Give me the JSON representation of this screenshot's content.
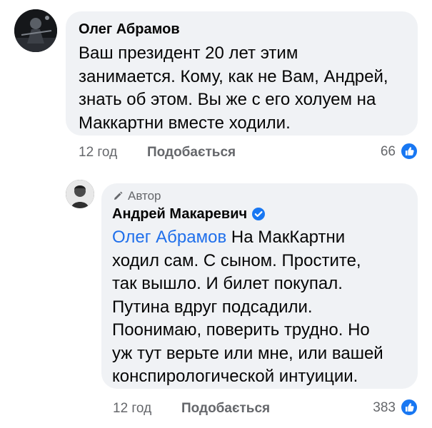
{
  "comments": [
    {
      "author": "Олег Абрамов",
      "text": "Ваш президент 20 лет этим\nзанимается. Кому, как не Вам, Андрей,\nзнать об этом. Вы же с его холуем на\nМаккартни вместе ходили.",
      "time": "12 год",
      "like_label": "Подобається",
      "like_count": "66"
    }
  ],
  "reply": {
    "badge_label": "Автор",
    "author": "Андрей Макаревич",
    "mention": "Олег Абрамов",
    "text_after_mention": " На МакКартни\nходил сам. С сыном. Простите,\nтак вышло. И билет покупал.\nПутина вдруг подсадили.\nПоонимаю, поверить трудно. Но\nуж тут верьте или мне, или вашей\nконспирологической интуиции.",
    "time": "12 год",
    "like_label": "Подобається",
    "like_count": "383"
  },
  "icons": {
    "like": "thumbs-up-icon",
    "verified": "verified-badge-icon",
    "author_badge": "pen-icon"
  },
  "colors": {
    "bubble": "#f0f2f5",
    "like_blue": "#1877f2",
    "mention": "#1f6feb",
    "meta_gray": "#65676b"
  }
}
